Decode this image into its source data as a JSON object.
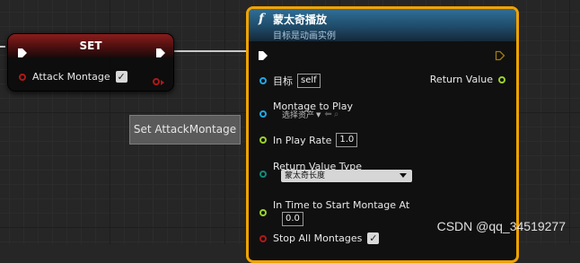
{
  "set_node": {
    "title": "SET",
    "variable_label": "Attack Montage",
    "checkbox_mark": "✓"
  },
  "floating_label": "Set AttackMontage",
  "function_node": {
    "icon": "f",
    "title": "蒙太奇播放",
    "subtitle": "目标是动画实例",
    "target_label": "目标",
    "target_value": "self",
    "return_label": "Return Value",
    "montage_label": "Montage to Play",
    "montage_value": "选择资产",
    "play_rate_label": "In Play Rate",
    "play_rate_value": "1.0",
    "return_type_label": "Return Value Type",
    "return_type_value": "蒙太奇长度",
    "time_to_start_label": "In Time to Start Montage At",
    "time_to_start_value": "0.0",
    "stop_all_label": "Stop All Montages",
    "stop_all_mark": "✓"
  },
  "watermark": "CSDN @qq_34519277",
  "colors": {
    "function_border": "#f2a200",
    "exec_pin": "#ffffff",
    "object_pin": "#1ea7e8",
    "float_pin": "#9bd22a",
    "enum_pin": "#0c8c7a",
    "bool_pin": "#b01818"
  }
}
